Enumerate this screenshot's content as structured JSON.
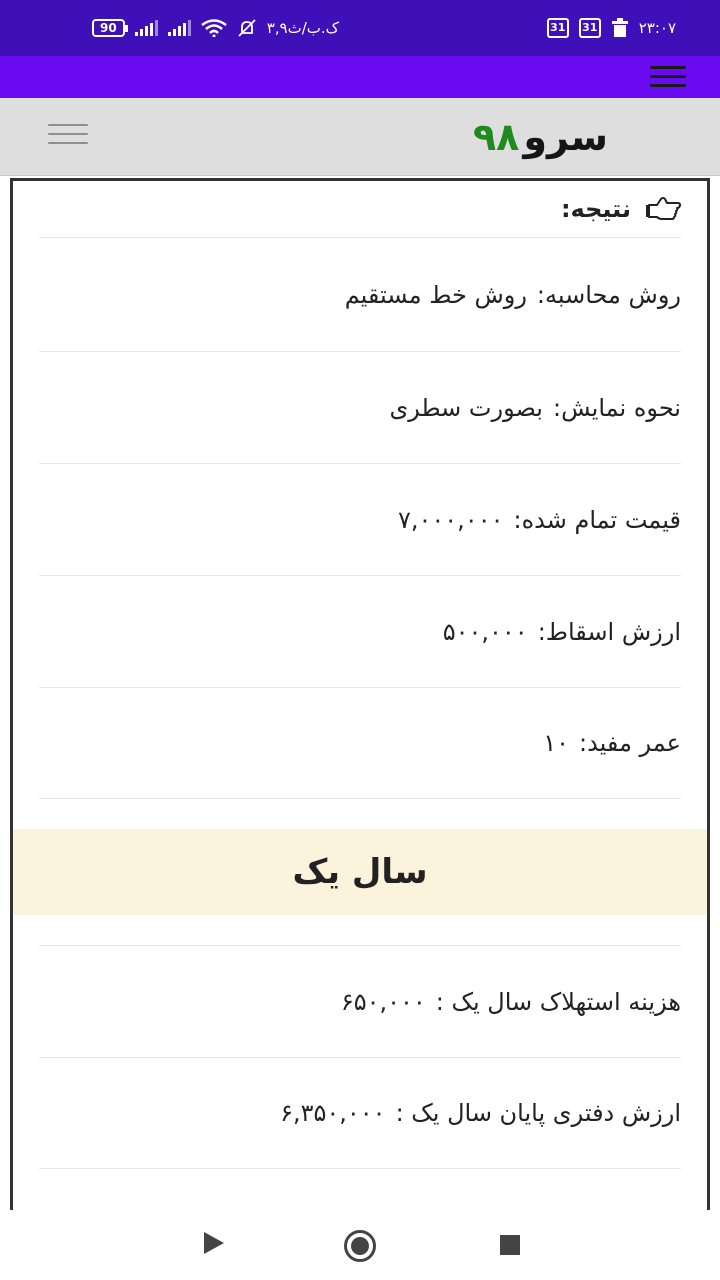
{
  "status_bar": {
    "battery": "90",
    "left_text": "۳‚۹ک.ب/ث",
    "calendar_1": "31",
    "calendar_2": "31",
    "time": "۲۳:۰۷"
  },
  "header": {
    "logo_word": "سرو",
    "logo_number": "۹۸"
  },
  "result": {
    "heading": "نتیجه:",
    "rows": [
      {
        "label": "روش محاسبه:",
        "value": "روش خط مستقیم"
      },
      {
        "label": "نحوه نمایش:",
        "value": "بصورت سطری"
      },
      {
        "label": "قیمت تمام شده:",
        "value": "۷,۰۰۰,۰۰۰"
      },
      {
        "label": "ارزش اسقاط:",
        "value": "۵۰۰,۰۰۰"
      },
      {
        "label": "عمر مفید:",
        "value": "۱۰"
      }
    ]
  },
  "year_one": {
    "title": "سال یک",
    "rows": [
      {
        "label": "هزینه استهلاک سال یک :",
        "value": "۶۵۰,۰۰۰"
      },
      {
        "label": "ارزش دفتری پایان سال  یک :",
        "value": "۶,۳۵۰,۰۰۰"
      }
    ]
  },
  "icons": {
    "pointer": "hand-pointing-icon",
    "menu": "hamburger-menu-icon"
  },
  "colors": {
    "status_bar": "#3f10b8",
    "app_bar": "#6a0af0",
    "logo_green": "#1f8a1f",
    "year_band": "#fcf3dc"
  }
}
